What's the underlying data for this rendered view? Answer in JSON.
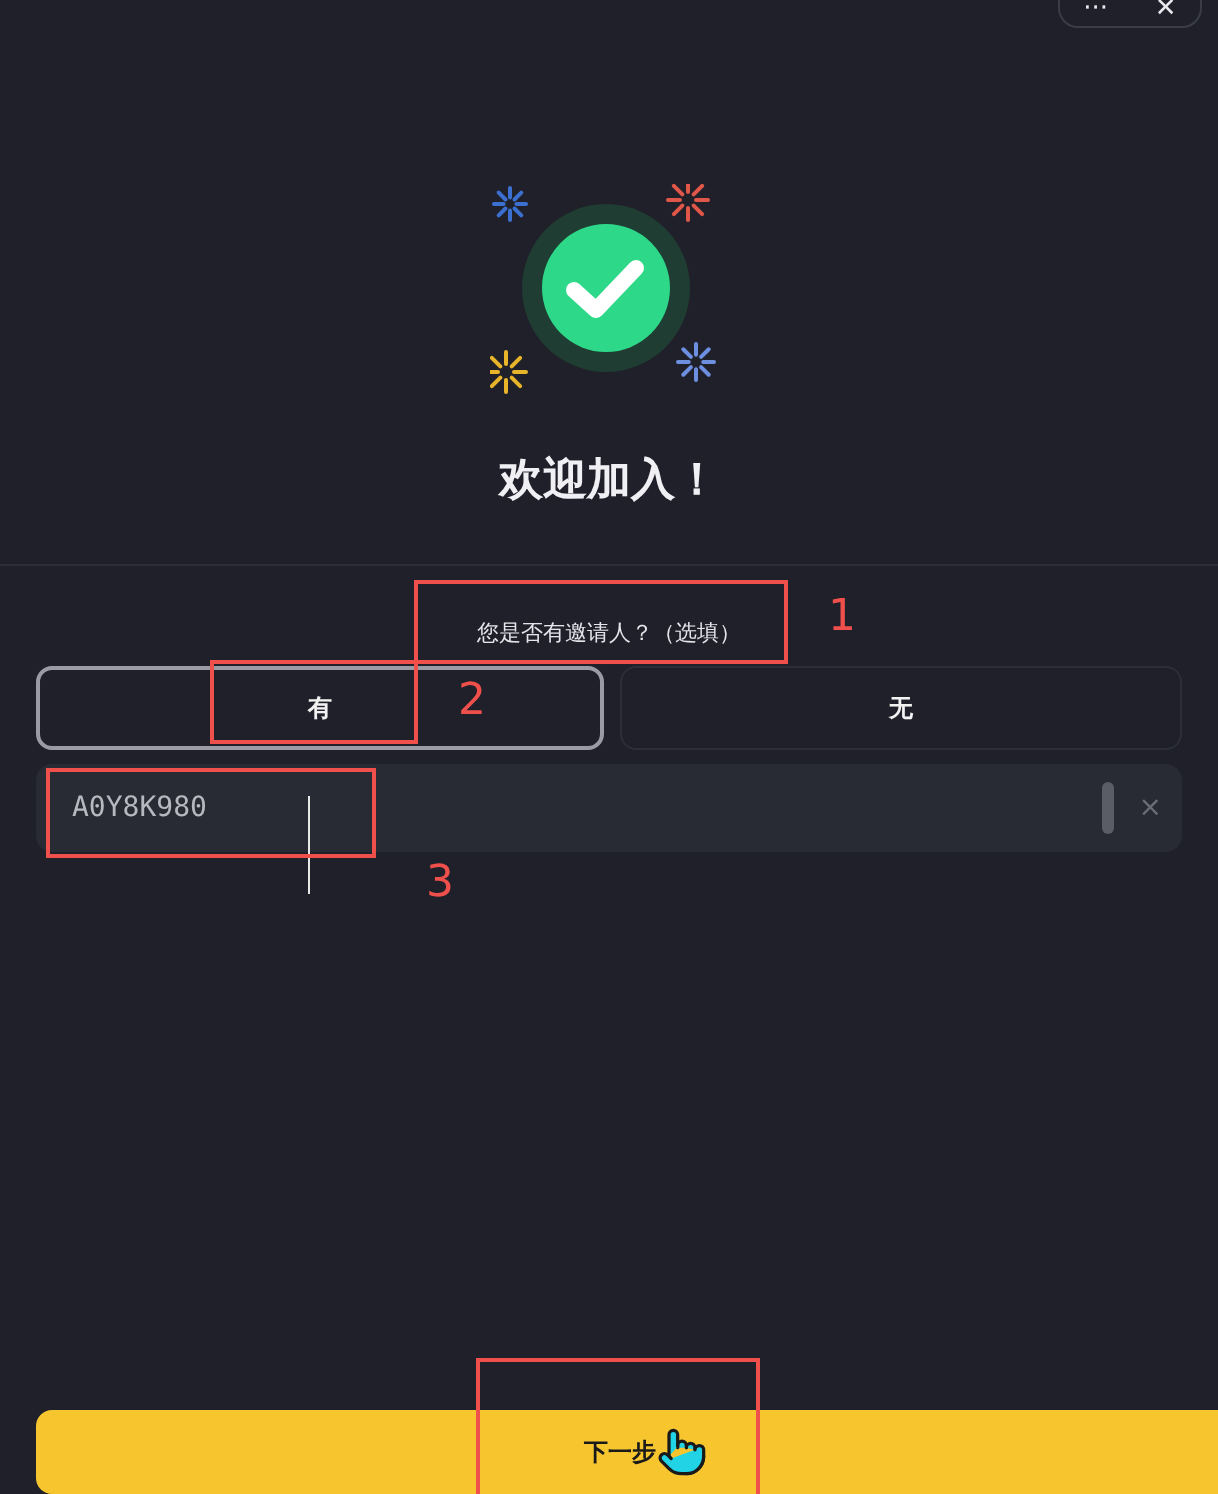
{
  "window_controls": {
    "more": "···",
    "close": "✕"
  },
  "title": "欢迎加入！",
  "question": "您是否有邀请人？（选填）",
  "options": [
    {
      "label": "有",
      "selected": true
    },
    {
      "label": "无",
      "selected": false
    }
  ],
  "invite_field": {
    "value": "A0Y8K980",
    "clear": "×"
  },
  "next_button": "下一步",
  "annotations": [
    {
      "label": "1",
      "kind": "numbered"
    },
    {
      "label": "2",
      "kind": "numbered"
    },
    {
      "label": "3",
      "kind": "numbered"
    },
    {
      "kind": "plain"
    }
  ]
}
